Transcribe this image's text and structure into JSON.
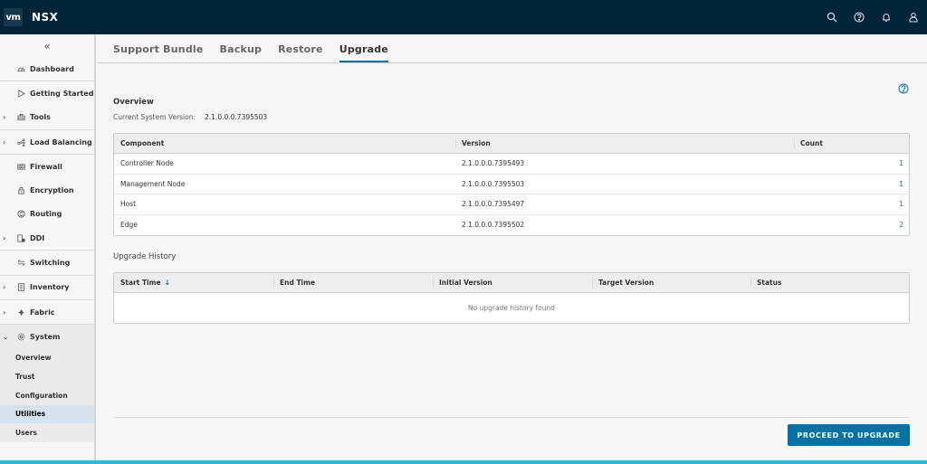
{
  "header": {
    "logo": "vm",
    "product": "NSX",
    "icons": [
      "search-icon",
      "help-icon",
      "bell-icon",
      "user-icon"
    ]
  },
  "sidebar": {
    "collapse_glyph": "«",
    "items": [
      {
        "label": "Dashboard",
        "icon": "dashboard-icon",
        "expandable": false
      },
      {
        "label": "Getting Started",
        "icon": "play-icon",
        "expandable": false
      },
      {
        "label": "Tools",
        "icon": "toolbox-icon",
        "expandable": true
      },
      {
        "label": "Load Balancing",
        "icon": "load-balancer-icon",
        "expandable": true
      },
      {
        "label": "Firewall",
        "icon": "firewall-icon",
        "expandable": false
      },
      {
        "label": "Encryption",
        "icon": "lock-icon",
        "expandable": false
      },
      {
        "label": "Routing",
        "icon": "routing-icon",
        "expandable": false
      },
      {
        "label": "DDI",
        "icon": "ddi-icon",
        "expandable": true
      },
      {
        "label": "Switching",
        "icon": "switching-icon",
        "expandable": false
      },
      {
        "label": "Inventory",
        "icon": "inventory-icon",
        "expandable": true
      },
      {
        "label": "Fabric",
        "icon": "fabric-icon",
        "expandable": true
      },
      {
        "label": "System",
        "icon": "gear-icon",
        "expandable": true,
        "expanded": true
      }
    ],
    "system_children": [
      {
        "label": "Overview",
        "active": false
      },
      {
        "label": "Trust",
        "active": false
      },
      {
        "label": "Configuration",
        "active": false
      },
      {
        "label": "Utilities",
        "active": true
      },
      {
        "label": "Users",
        "active": false
      }
    ]
  },
  "tabs": [
    {
      "label": "Support Bundle",
      "active": false
    },
    {
      "label": "Backup",
      "active": false
    },
    {
      "label": "Restore",
      "active": false
    },
    {
      "label": "Upgrade",
      "active": true
    }
  ],
  "overview": {
    "title": "Overview",
    "version_label": "Current System Version:",
    "version_value": "2.1.0.0.0.7395503"
  },
  "components_table": {
    "columns": [
      "Component",
      "Version",
      "Count"
    ],
    "rows": [
      {
        "component": "Controller Node",
        "version": "2.1.0.0.0.7395493",
        "count": "1"
      },
      {
        "component": "Management Node",
        "version": "2.1.0.0.0.7395503",
        "count": "1"
      },
      {
        "component": "Host",
        "version": "2.1.0.0.0.7395497",
        "count": "1"
      },
      {
        "component": "Edge",
        "version": "2.1.0.0.0.7395502",
        "count": "2"
      }
    ]
  },
  "history": {
    "title": "Upgrade History",
    "columns": [
      "Start Time",
      "End Time",
      "Initial Version",
      "Target Version",
      "Status"
    ],
    "sort_glyph": "↓",
    "empty_text": "No upgrade history found"
  },
  "actions": {
    "proceed_label": "PROCEED TO UPGRADE"
  },
  "colors": {
    "header_bg": "#002538",
    "accent": "#0072a3",
    "active_nav": "#d5e3ee",
    "bottom_bar": "#2fb8de"
  }
}
